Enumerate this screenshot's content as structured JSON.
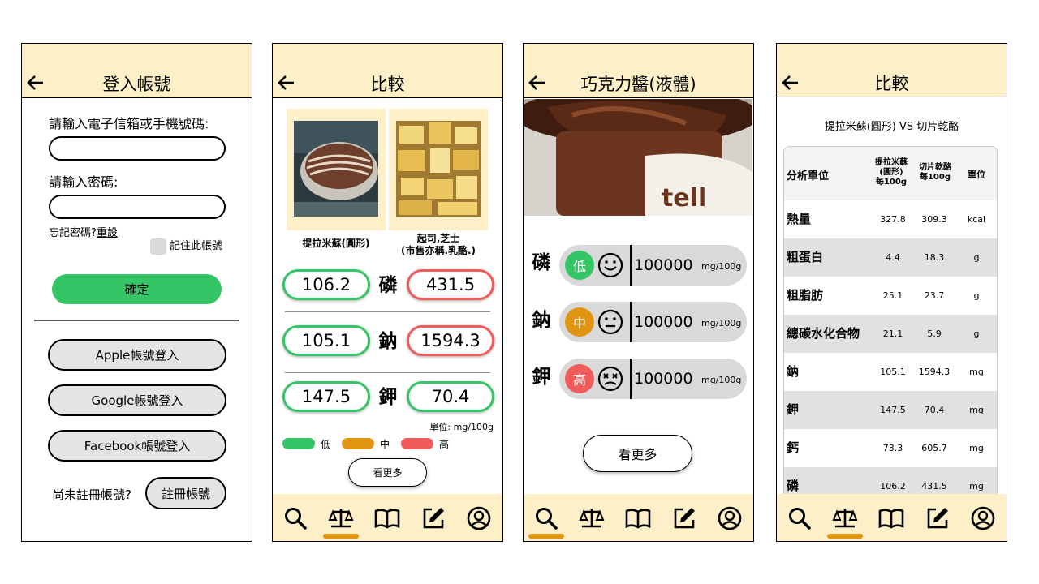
{
  "login": {
    "title": "登入帳號",
    "email_label": "請輸入電子信箱或手機號碼:",
    "password_label": "請輸入密碼:",
    "forgot_text": "忘記密碼?",
    "reset_link": "重設",
    "remember_label": "記住此帳號",
    "confirm_button": "確定",
    "apple_button": "Apple帳號登入",
    "google_button": "Google帳號登入",
    "facebook_button": "Facebook帳號登入",
    "no_account_text": "尚未註冊帳號?",
    "register_button": "註冊帳號"
  },
  "compare": {
    "title": "比較",
    "food1": "提拉米蘇(圓形)",
    "food2_line1": "起司,芝士",
    "food2_line2": "(市售亦稱.乳酪.)",
    "rows": [
      {
        "nutrient": "磷",
        "left": "106.2",
        "right": "431.5"
      },
      {
        "nutrient": "鈉",
        "left": "105.1",
        "right": "1594.3"
      },
      {
        "nutrient": "鉀",
        "left": "147.5",
        "right": "70.4"
      }
    ],
    "unit_note": "單位: mg/100g",
    "legend": {
      "low": "低",
      "mid": "中",
      "high": "高"
    },
    "more_button": "看更多"
  },
  "detail": {
    "title": "巧克力醬(液體)",
    "photo_brand_text": "tell",
    "rows": [
      {
        "nutrient": "磷",
        "level": "低",
        "value": "100000",
        "unit": "mg/100g"
      },
      {
        "nutrient": "鈉",
        "level": "中",
        "value": "100000",
        "unit": "mg/100g"
      },
      {
        "nutrient": "鉀",
        "level": "高",
        "value": "100000",
        "unit": "mg/100g"
      }
    ],
    "more_button": "看更多"
  },
  "table_page": {
    "title": "比較",
    "subtitle": "提拉米蘇(圓形) VS 切片乾酪",
    "headers": {
      "col0": "分析單位",
      "col1_l1": "提拉米蘇",
      "col1_l2": "(圓形)",
      "col1_l3": "每100g",
      "col2_l1": "切片乾酪",
      "col2_l2": "每100g",
      "col3": "單位"
    },
    "rows": [
      {
        "name": "熱量",
        "a": "327.8",
        "b": "309.3",
        "unit": "kcal"
      },
      {
        "name": "粗蛋白",
        "a": "4.4",
        "b": "18.3",
        "unit": "g"
      },
      {
        "name": "粗脂肪",
        "a": "25.1",
        "b": "23.7",
        "unit": "g"
      },
      {
        "name": "總碳水化合物",
        "a": "21.1",
        "b": "5.9",
        "unit": "g"
      },
      {
        "name": "鈉",
        "a": "105.1",
        "b": "1594.3",
        "unit": "mg"
      },
      {
        "name": "鉀",
        "a": "147.5",
        "b": "70.4",
        "unit": "mg"
      },
      {
        "name": "鈣",
        "a": "73.3",
        "b": "605.7",
        "unit": "mg"
      },
      {
        "name": "磷",
        "a": "106.2",
        "b": "431.5",
        "unit": "mg"
      }
    ]
  },
  "nav_icons": [
    "search-icon",
    "scale-icon",
    "book-icon",
    "edit-icon",
    "profile-icon"
  ],
  "colors": {
    "header_bg": "#fdf0c8",
    "green": "#35c566",
    "orange": "#e09510",
    "red": "#f05b5b",
    "grey": "#d9d9d9"
  }
}
